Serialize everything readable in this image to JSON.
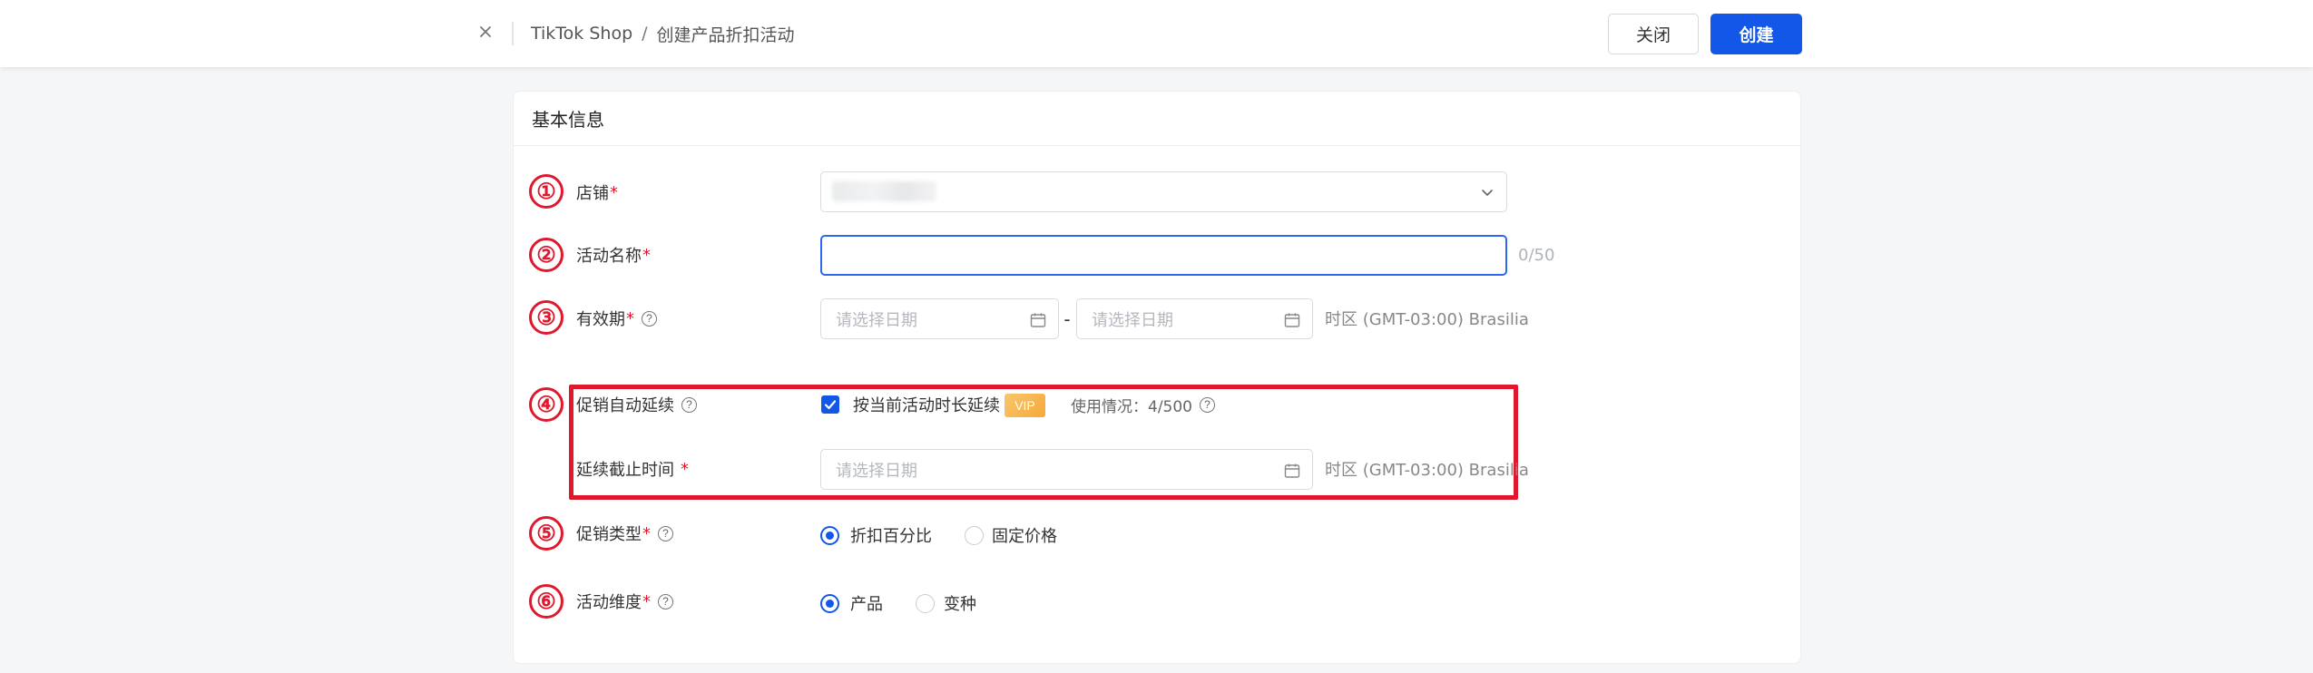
{
  "header": {
    "breadcrumb_root": "TikTok Shop",
    "breadcrumb_sep": "/",
    "breadcrumb_current": "创建产品折扣活动",
    "close_button": "关闭",
    "create_button": "创建"
  },
  "card": {
    "title": "基本信息"
  },
  "markers": [
    "①",
    "②",
    "③",
    "④",
    "⑤",
    "⑥"
  ],
  "form": {
    "shop": {
      "label": "店铺",
      "required": "*"
    },
    "name": {
      "label": "活动名称",
      "required": "*",
      "counter": "0/50"
    },
    "period": {
      "label": "有效期",
      "required": "*",
      "start_placeholder": "请选择日期",
      "end_placeholder": "请选择日期",
      "dash": "-",
      "timezone": "时区 (GMT-03:00) Brasilia"
    },
    "auto_extend": {
      "label": "促销自动延续",
      "checkbox_label": "按当前活动时长延续",
      "checked": true,
      "vip_badge": "VIP",
      "usage": "使用情况：4/500"
    },
    "extend_deadline": {
      "label": "延续截止时间",
      "required": "*",
      "placeholder": "请选择日期",
      "timezone": "时区 (GMT-03:00) Brasilia"
    },
    "promo_type": {
      "label": "促销类型",
      "required": "*",
      "options": [
        "折扣百分比",
        "固定价格"
      ],
      "selected": "折扣百分比"
    },
    "dimension": {
      "label": "活动维度",
      "required": "*",
      "options": [
        "产品",
        "变种"
      ],
      "selected": "产品"
    }
  },
  "colors": {
    "primary": "#1357e8",
    "marker_red": "#e0182d",
    "vip_gold": "#f5a93a"
  }
}
